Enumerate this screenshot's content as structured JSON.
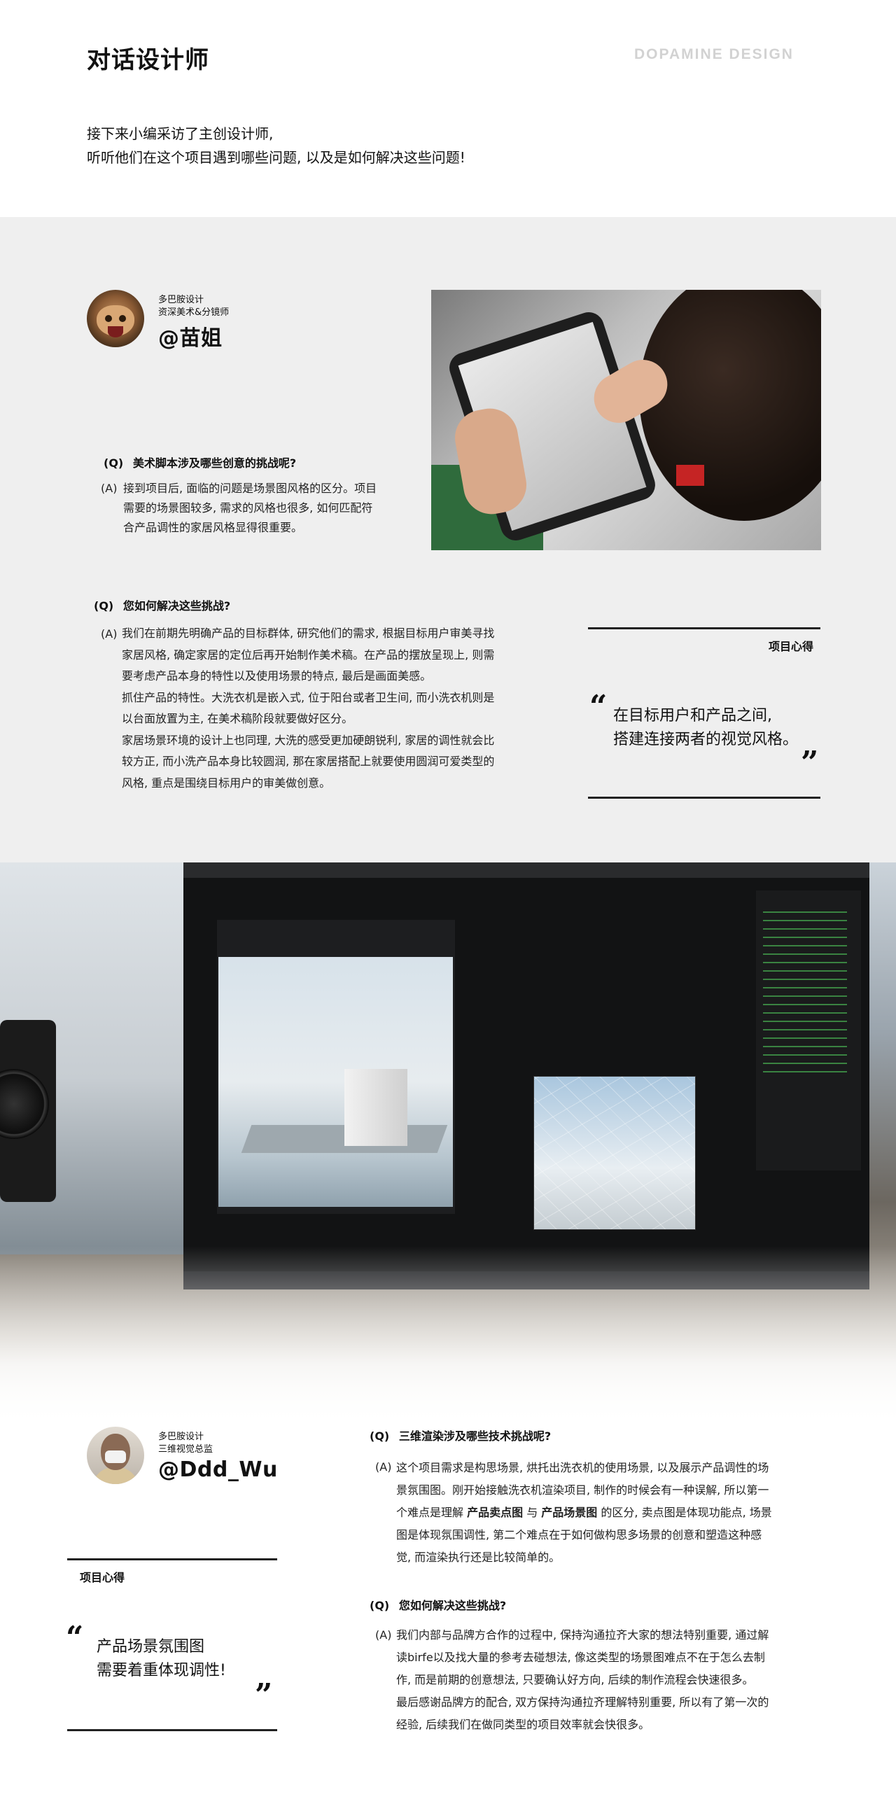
{
  "header": {
    "title": "对话设计师",
    "brand": "DOPAMINE DESIGN",
    "intro_line1": "接下来小编采访了主创设计师,",
    "intro_line2": "听听他们在这个项目遇到哪些问题, 以及是如何解决这些问题!"
  },
  "designer1": {
    "company": "多巴胺设计",
    "role": "资深美术&分镜师",
    "handle": "@苗姐",
    "q1_marker": "(Q)",
    "q1": "美术脚本涉及哪些创意的挑战呢?",
    "a_marker": "(A)",
    "a1_lines": [
      "接到项目后, 面临的问题是场景图风格的区分。项目",
      "需要的场景图较多, 需求的风格也很多, 如何匹配符",
      "合产品调性的家居风格显得很重要。"
    ],
    "q2_marker": "(Q)",
    "q2": "您如何解决这些挑战?",
    "a2_lines": [
      "我们在前期先明确产品的目标群体, 研究他们的需求, 根据目标用户审美寻找",
      "家居风格, 确定家居的定位后再开始制作美术稿。在产品的摆放呈现上, 则需",
      "要考虑产品本身的特性以及使用场景的特点, 最后是画面美感。",
      "抓住产品的特性。大洗衣机是嵌入式, 位于阳台或者卫生间, 而小洗衣机则是",
      "以台面放置为主, 在美术稿阶段就要做好区分。",
      "家居场景环境的设计上也同理, 大洗的感受更加硬朗锐利, 家居的调性就会比",
      "较方正, 而小洗产品本身比较圆润, 那在家居搭配上就要使用圆润可爱类型的",
      "风格, 重点是围绕目标用户的审美做创意。"
    ],
    "quote_label": "项目心得",
    "quote_line1": "在目标用户和产品之间,",
    "quote_line2": "搭建连接两者的视觉风格。"
  },
  "designer2": {
    "company": "多巴胺设计",
    "role": "三维视觉总监",
    "handle": "@Ddd_Wu",
    "q1_marker": "(Q)",
    "q1": "三维渲染涉及哪些技术挑战呢?",
    "a_marker": "(A)",
    "a1_line1": "这个项目需求是构思场景, 烘托出洗衣机的使用场景, 以及展示产品调性的场",
    "a1_line2": "景氛围图。刚开始接触洗衣机渲染项目, 制作的时候会有一种误解, 所以第一",
    "a1_line3_pre": "个难点是理解 ",
    "a1_line3_b1": "产品卖点图",
    "a1_line3_mid": " 与 ",
    "a1_line3_b2": "产品场景图",
    "a1_line3_post": " 的区分, 卖点图是体现功能点, 场景",
    "a1_line4": "图是体现氛围调性, 第二个难点在于如何做构思多场景的创意和塑造这种感",
    "a1_line5": "觉, 而渲染执行还是比较简单的。",
    "q2_marker": "(Q)",
    "q2": "您如何解决这些挑战?",
    "a2_lines": [
      "我们内部与品牌方合作的过程中, 保持沟通拉齐大家的想法特别重要, 通过解",
      "读birfe以及找大量的参考去碰想法, 像这类型的场景图难点不在于怎么去制",
      "作, 而是前期的创意想法, 只要确认好方向, 后续的制作流程会快速很多。",
      "最后感谢品牌方的配合, 双方保持沟通拉齐理解特别重要, 所以有了第一次的",
      "经验, 后续我们在做同类型的项目效率就会快很多。"
    ],
    "quote_label": "项目心得",
    "quote_line1": "产品场景氛围图",
    "quote_line2": "需要着重体现调性!"
  },
  "icons": {
    "open_quote": "“",
    "close_quote": "”"
  }
}
